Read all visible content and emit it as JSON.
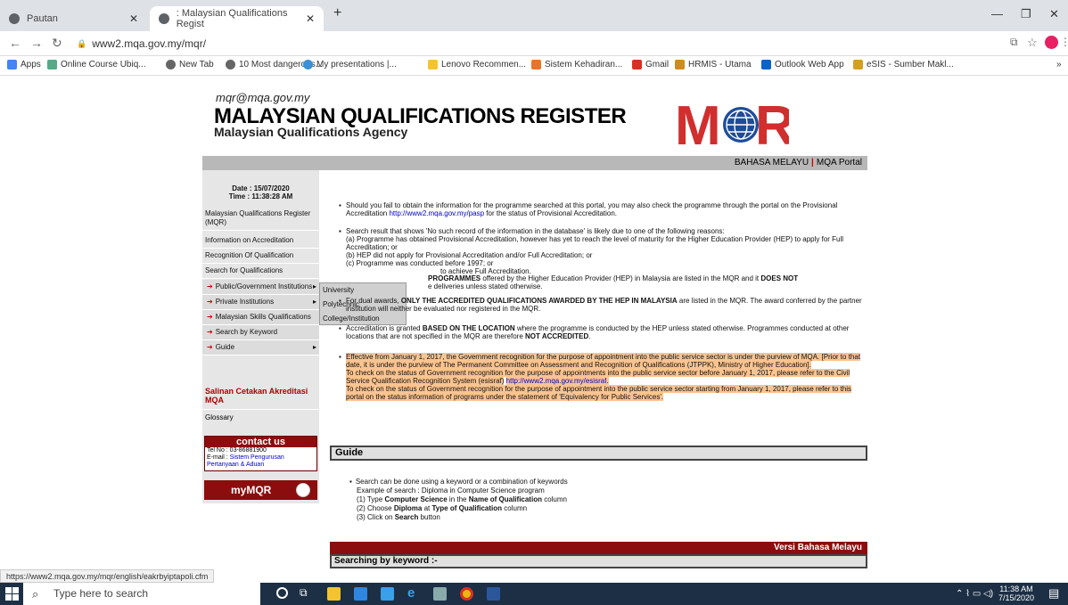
{
  "browser": {
    "tabs": [
      {
        "label": "Pautan"
      },
      {
        "label": ": Malaysian Qualifications Regist"
      }
    ],
    "new_tab": "+",
    "url": "www2.mqa.gov.my/mqr/",
    "bookmarks": [
      "Apps",
      "Online Course Ubiq...",
      "New Tab",
      "10 Most dangerous...",
      "My presentations |...",
      "Lenovo Recommen...",
      "Sistem Kehadiran...",
      "Gmail",
      "HRMIS - Utama",
      "Outlook Web App",
      "eSIS - Sumber Makl..."
    ]
  },
  "header": {
    "email": "mqr@mqa.gov.my",
    "title": "MALAYSIAN QUALIFICATIONS REGISTER",
    "subtitle": "Malaysian Qualifications Agency",
    "logo_text": "MQR",
    "lang_link": "BAHASA MELAYU",
    "portal_link": "MQA Portal"
  },
  "sidebar": {
    "date": "Date : 15/07/2020",
    "time": "Time : 11:38:28 AM",
    "items": [
      "Malaysian Qualifications Register (MQR)",
      "Information on Accreditation",
      "Recognition Of Qualification",
      "Search for Qualifications"
    ],
    "subitems": [
      "Public/Government Institutions",
      "Private Institutions",
      "Malaysian Skills Qualifications",
      "Search by Keyword",
      "Guide"
    ],
    "salinan": "Salinan Cetakan Akreditasi MQA",
    "glossary": "Glossary",
    "contact_title": "contact us",
    "tel": "Tel No : 03-86881900",
    "email_label": "E-mail :",
    "email_link": "Sistem Pengurusan Pertanyaan & Aduan",
    "mymqr": "myMQR"
  },
  "flyout": [
    "University",
    "Polytechnic",
    "College/Institution"
  ],
  "main": {
    "p1a": "Should you fail to obtain the information for the programme searched at this portal, you may also check the programme through the portal on the Provisional Accreditation",
    "p1link": "http://www2.mqa.gov.my/pasp",
    "p1b": "for the status of Provisional Accreditation.",
    "p2a": "Search result that shows 'No such record of the information in the database' is likely due to one of the following reasons:",
    "p2b": "(a) Programme has obtained Provisional Accreditation, however has yet to reach the level of maturity for the Higher Education Provider (HEP) to apply for Full Accreditation; or",
    "p2c": "(b) HEP did not apply for Provisional Accreditation and/or Full Accreditation; or",
    "p2d": "(c) Programme was conducted before 1997; or",
    "p2e": "to achieve Full Accreditation.",
    "p3a": "PROGRAMMES",
    "p3b": "offered by the Higher Education Provider (HEP) in Malaysia are listed in the MQR and it",
    "p3c": "DOES NOT",
    "p3d": "e deliveries unless stated otherwise.",
    "p4a": "For dual awards,",
    "p4b": "ONLY THE ACCREDITED QUALIFICATIONS AWARDED BY THE HEP IN MALAYSIA",
    "p4c": "are listed in the MQR. The award conferred by the partner institution will neither be evaluated nor registered in the MQR.",
    "p5a": "Accreditation is granted",
    "p5b": "BASED ON THE LOCATION",
    "p5c": "where the programme is conducted by the HEP unless stated otherwise. Programmes conducted at other locations that are not specified in the MQR are therefore",
    "p5d": "NOT ACCREDITED",
    "p6a": "Effective from January 1, 2017, the Government recognition for the purpose of appointment into the public service sector is under the purview of MQA. [Prior to that date, it is under the purview of The Permanent Committee on Assessment and Recognition of Qualifications (JTPPK), Ministry of Higher Education].",
    "p6b": "To check on the status of Government recognition for the purpose of appointments into the public service sector before January 1, 2017, please refer to the Civil Service Qualification Recognition System (esisraf)",
    "p6link": "http://www2.mqa.gov.my/esisraf",
    "p6c": "To check on the status of Government recognition for the purpose of appointment into the public service sector starting from January 1, 2017, please refer to this portal on the status information of programs under the statement of 'Equivalency for Public Services'."
  },
  "guide": {
    "title": "Guide",
    "l1": "Search can be done using a keyword or a combination of keywords",
    "l2": "Example of search : Diploma in Computer Science program",
    "l3a": "(1) Type",
    "l3b": "Computer Science",
    "l3c": "in the",
    "l3d": "Name of Qualification",
    "l3e": "column",
    "l4a": "(2) Choose",
    "l4b": "Diploma",
    "l4c": "at",
    "l4d": "Type of Qualification",
    "l4e": "column",
    "l5a": "(3) Click on",
    "l5b": "Search",
    "l5c": "button"
  },
  "versi": "Versi Bahasa Melayu",
  "search_heading": "Searching by keyword :-",
  "status_url": "https://www2.mqa.gov.my/mqr/english/eakrbyiptapoli.cfm",
  "taskbar": {
    "search_placeholder": "Type here to search",
    "time": "11:38 AM",
    "date": "7/15/2020"
  }
}
